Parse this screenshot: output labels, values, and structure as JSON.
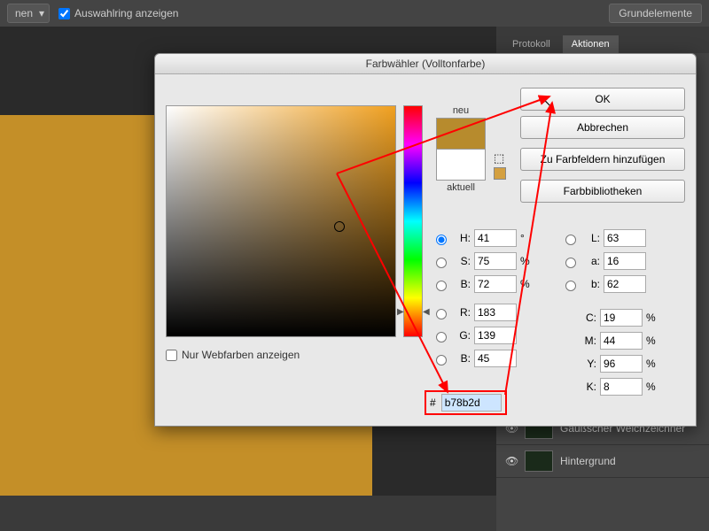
{
  "topbar": {
    "dropdown": "nen",
    "checkbox_label": "Auswahlring anzeigen",
    "grund_label": "Grundelemente"
  },
  "right": {
    "tab_protokoll": "Protokoll",
    "tab_aktionen": "Aktionen",
    "layer1": "Gaußscher Weichzeichner",
    "layer2": "Hintergrund"
  },
  "dialog": {
    "title": "Farbwähler (Volltonfarbe)",
    "ok": "OK",
    "cancel": "Abbrechen",
    "add_swatch": "Zu Farbfeldern hinzufügen",
    "libs": "Farbbibliotheken",
    "neu": "neu",
    "aktuell": "aktuell",
    "webonly": "Nur Webfarben anzeigen",
    "H": "41",
    "S": "75",
    "Bv": "72",
    "R": "183",
    "G": "139",
    "B": "45",
    "L": "63",
    "a": "16",
    "b": "62",
    "C": "19",
    "M": "44",
    "Y": "96",
    "K": "8",
    "hex": "b78b2d",
    "lbl": {
      "H": "H:",
      "S": "S:",
      "Bv": "B:",
      "R": "R:",
      "G": "G:",
      "B": "B:",
      "L": "L:",
      "a": "a:",
      "b": "b:",
      "C": "C:",
      "M": "M:",
      "Y": "Y:",
      "K": "K:",
      "deg": "°",
      "pct": "%",
      "hash": "#"
    }
  }
}
